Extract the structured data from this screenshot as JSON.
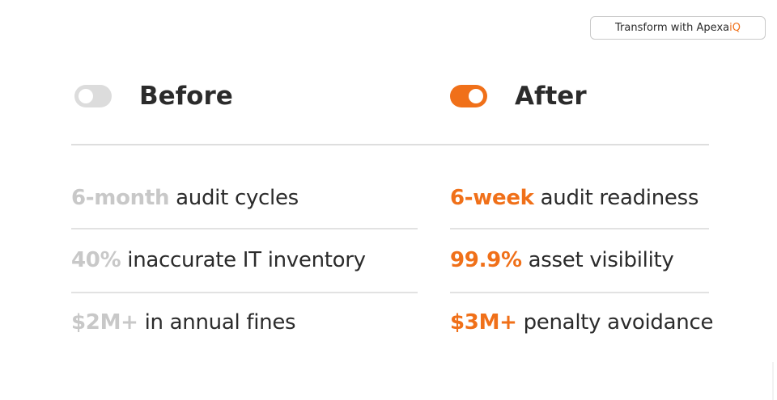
{
  "cta": {
    "label_prefix": "Transform with Apexa",
    "label_accent": "iQ"
  },
  "before": {
    "heading": "Before",
    "toggle_state": "off",
    "rows": [
      {
        "highlight": "6-month",
        "text": " audit cycles"
      },
      {
        "highlight": "40%",
        "text": " inaccurate IT inventory"
      },
      {
        "highlight": "$2M+",
        "text": " in annual fines"
      }
    ]
  },
  "after": {
    "heading": "After",
    "toggle_state": "on",
    "rows": [
      {
        "highlight": "6-week",
        "text": " audit readiness"
      },
      {
        "highlight": "99.9%",
        "text": " asset visibility"
      },
      {
        "highlight": "$3M+",
        "text": " penalty avoidance"
      }
    ]
  },
  "colors": {
    "accent": "#f07019",
    "muted_highlight": "#c8c8c8",
    "text": "#2b2b2b",
    "toggle_off": "#dcdcdc"
  }
}
